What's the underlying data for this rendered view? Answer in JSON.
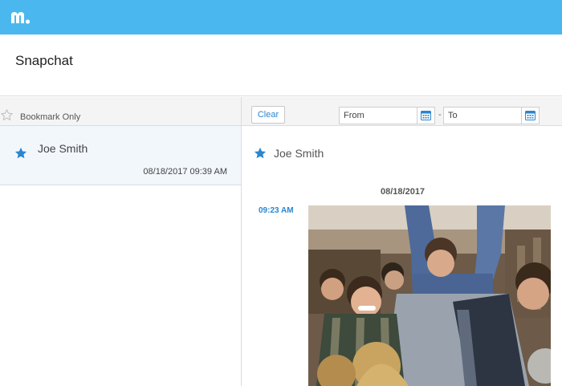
{
  "app": {
    "logo_icon": "mspy-logo-icon",
    "brand_color": "#4ab8ee"
  },
  "page": {
    "title": "Snapchat"
  },
  "left_toolbar": {
    "bookmark_label": "Bookmark Only",
    "bookmark_icon": "star-outline-icon"
  },
  "right_toolbar": {
    "clear_label": "Clear",
    "from_placeholder": "From",
    "to_placeholder": "To",
    "separator": "-",
    "calendar_icon": "calendar-icon"
  },
  "conversations": [
    {
      "name": "Joe Smith",
      "timestamp": "08/18/2017 09:39 AM",
      "bookmarked": true
    }
  ],
  "chat": {
    "contact_name": "Joe Smith",
    "date_header": "08/18/2017",
    "messages": [
      {
        "time": "09:23 AM",
        "type": "image",
        "description_icon": "photo-attachment"
      }
    ]
  },
  "colors": {
    "accent": "#2a86d0",
    "star": "#2a86d0",
    "selected_row": "#f2f7fc"
  }
}
